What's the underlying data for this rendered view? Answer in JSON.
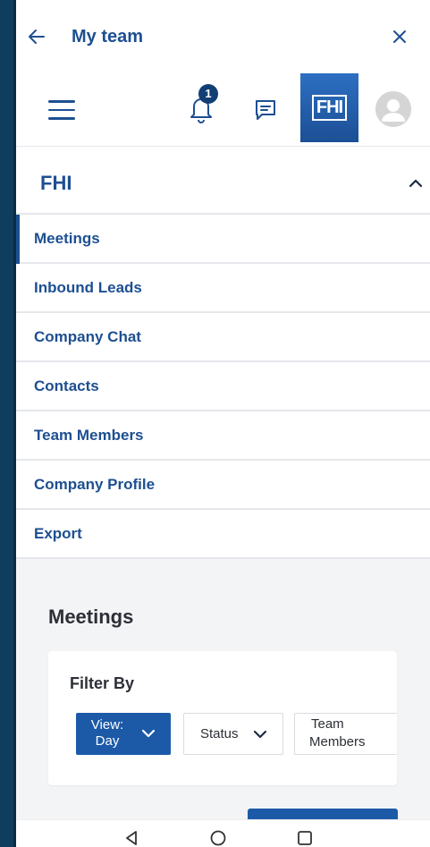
{
  "header": {
    "title": "My team",
    "back_icon": "arrow-left-icon",
    "close_icon": "close-icon"
  },
  "toolbar": {
    "menu_icon": "hamburger-icon",
    "notifications_icon": "bell-icon",
    "notification_count": "1",
    "chat_icon": "chat-icon",
    "company_logo_text": "FHI",
    "avatar_icon": "user-avatar-icon"
  },
  "company": {
    "name": "FHI",
    "collapse_icon": "chevron-up-icon"
  },
  "menu": {
    "items": [
      {
        "label": "Meetings",
        "active": true
      },
      {
        "label": "Inbound Leads",
        "active": false
      },
      {
        "label": "Company Chat",
        "active": false
      },
      {
        "label": "Contacts",
        "active": false
      },
      {
        "label": "Team Members",
        "active": false
      },
      {
        "label": "Company Profile",
        "active": false
      },
      {
        "label": "Export",
        "active": false
      }
    ]
  },
  "content": {
    "title": "Meetings",
    "filter": {
      "label": "Filter By",
      "view_chip_line1": "View:",
      "view_chip_line2": "Day",
      "status_chip": "Status",
      "team_chip_line1": "Team",
      "team_chip_line2": "Members"
    }
  },
  "system_nav": {
    "back_icon": "triangle-back-icon",
    "home_icon": "circle-home-icon",
    "recents_icon": "square-recents-icon"
  },
  "colors": {
    "primary": "#1d4f91",
    "accent": "#1c5aa8",
    "sidebar_strip": "#0e3d5e",
    "content_bg": "#f3f4f6"
  }
}
